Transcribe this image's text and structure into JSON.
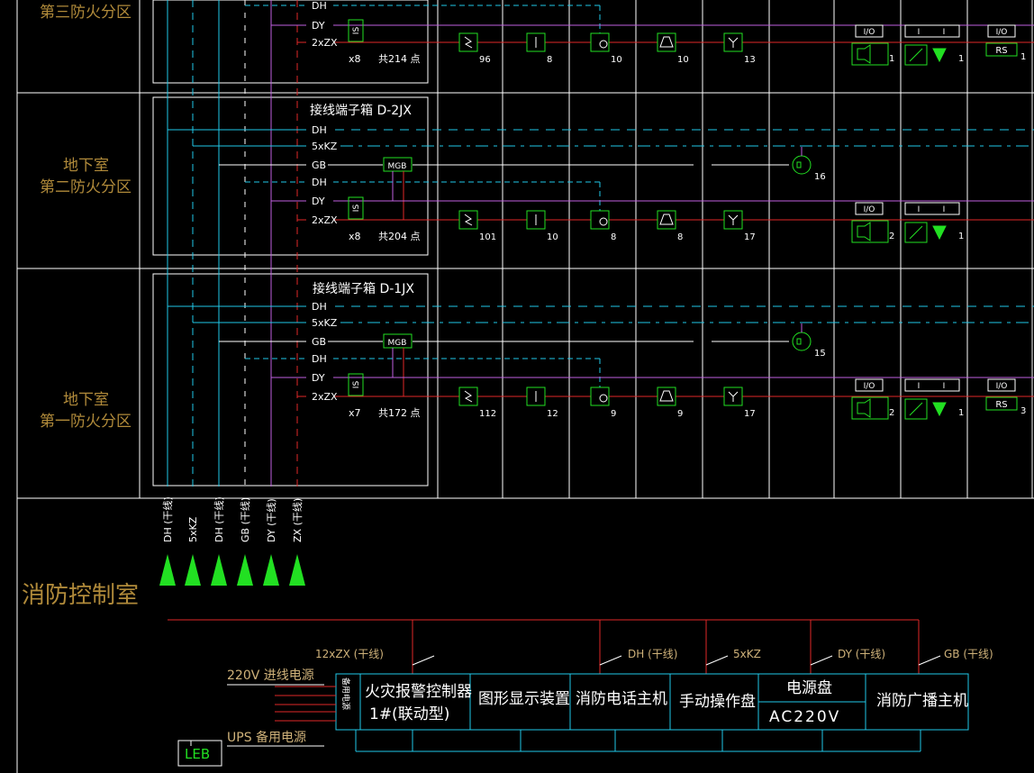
{
  "colors": {
    "background": "#000000",
    "frame": "#ffffff",
    "trunk_dh": "#21c8e8",
    "trunk_kz": "#21c8e8",
    "trunk_gb": "#ffffff",
    "trunk_dy": "#c060e0",
    "trunk_zx": "#e02828",
    "device": "#22e022",
    "zone_label": "#b08a3a"
  },
  "zones": [
    {
      "id": "z3",
      "label_line1": "",
      "label_line2": "第三防火分区",
      "box_title": "",
      "lines": [
        "DH",
        "DY",
        "2xZX"
      ],
      "module_count": "x8",
      "total_points": "共214 点",
      "has_speaker": false,
      "counts": {
        "smoke": "96",
        "heat": "8",
        "hydrant": "10",
        "manual": "10",
        "sprinkler": "13"
      },
      "io1_count": "1",
      "io2_count": "1",
      "rs_count": "1"
    },
    {
      "id": "z2",
      "label_line1": "地下室",
      "label_line2": "第二防火分区",
      "box_title": "接线端子箱  D-2JX",
      "lines": [
        "DH",
        "5xKZ",
        "GB",
        "DH",
        "DY",
        "2xZX"
      ],
      "module_count": "x8",
      "total_points": "共204 点",
      "has_speaker": true,
      "speaker_count": "16",
      "counts": {
        "smoke": "101",
        "heat": "10",
        "hydrant": "8",
        "manual": "8",
        "sprinkler": "17"
      },
      "io1_count": "2",
      "io2_count": "1",
      "rs_count": ""
    },
    {
      "id": "z1",
      "label_line1": "地下室",
      "label_line2": "第一防火分区",
      "box_title": "接线端子箱  D-1JX",
      "lines": [
        "DH",
        "5xKZ",
        "GB",
        "DH",
        "DY",
        "2xZX"
      ],
      "module_count": "x7",
      "total_points": "共172 点",
      "has_speaker": true,
      "speaker_count": "15",
      "counts": {
        "smoke": "112",
        "heat": "12",
        "hydrant": "9",
        "manual": "9",
        "sprinkler": "17"
      },
      "io1_count": "2",
      "io2_count": "1",
      "rs_count": "3"
    }
  ],
  "module_labels": {
    "isolator": "IS",
    "mgb": "MGB",
    "io": "I/O",
    "in": "I",
    "rs": "RS"
  },
  "vertical_labels": [
    "DH (干线)",
    "5xKZ",
    "DH (干线)",
    "GB (干线)",
    "DY (干线)",
    "ZX (干线)"
  ],
  "control_room": {
    "title": "消防控制室",
    "lead_labels": [
      "12xZX  (干线)",
      "DH (干线)",
      "5xKZ",
      "DY (干线)",
      "GB (干线)"
    ],
    "power_main": "220V   进线电源",
    "power_ups": "UPS  备用电源",
    "supply_box": "电源盘",
    "leb": "LEB",
    "panels": [
      {
        "line1": "火灾报警控制器",
        "line2": "1#(联动型)"
      },
      {
        "line1": "图形显示装置",
        "line2": ""
      },
      {
        "line1": "消防电话主机",
        "line2": ""
      },
      {
        "line1": "手动操作盘",
        "line2": ""
      },
      {
        "line1": "电源盘",
        "line2": "AC220V"
      },
      {
        "line1": "消防广播主机",
        "line2": ""
      }
    ],
    "side_label": "备用电源"
  }
}
